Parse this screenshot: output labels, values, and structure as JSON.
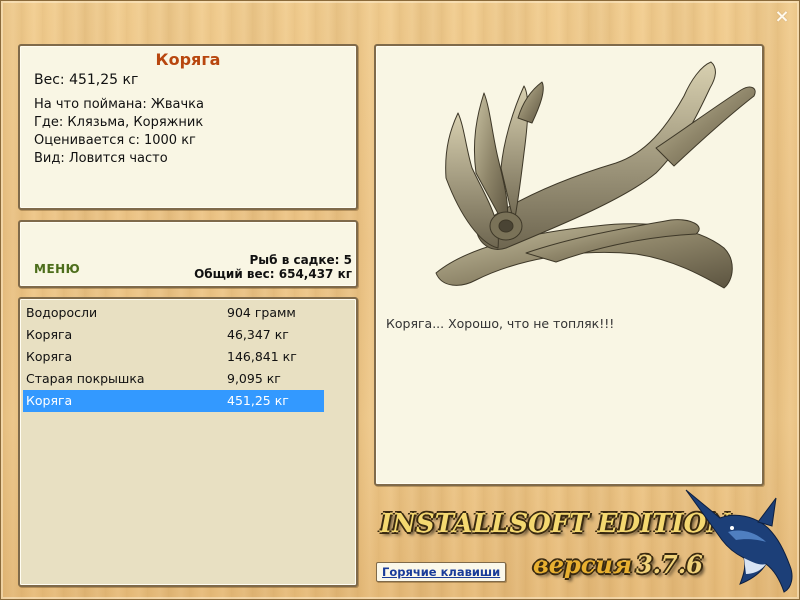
{
  "window": {
    "close_glyph": "×"
  },
  "info": {
    "title": "Коряга",
    "weight": "Вес: 451,25 кг",
    "details": [
      "На что поймана: Жвачка",
      "Где: Клязьма, Коряжник",
      "Оценивается с: 1000 кг",
      "Вид: Ловится часто"
    ]
  },
  "menu": {
    "button_label": "МЕНЮ",
    "fish_count": "Рыб в садке: 5",
    "total_weight": "Общий вес: 654,437 кг"
  },
  "catch_list": {
    "selected_index": 4,
    "rows": [
      {
        "name": "Водоросли",
        "weight": "904 грамм"
      },
      {
        "name": "Коряга",
        "weight": "46,347 кг"
      },
      {
        "name": "Коряга",
        "weight": "146,841 кг"
      },
      {
        "name": "Старая покрышка",
        "weight": "9,095 кг"
      },
      {
        "name": "Коряга",
        "weight": "451,25 кг"
      }
    ]
  },
  "photo": {
    "comment": "Коряга... Хорошо, что не топляк!!!"
  },
  "branding": {
    "title": "INSTALLSOFT EDITION",
    "version_label": "версия",
    "version_number": "3.7.6"
  },
  "hotkeys_label": "Горячие клавиши",
  "colors": {
    "title": "#b8460e",
    "selection": "#3399ff",
    "menu": "#4d6d1c",
    "link": "#1a3c9a"
  }
}
